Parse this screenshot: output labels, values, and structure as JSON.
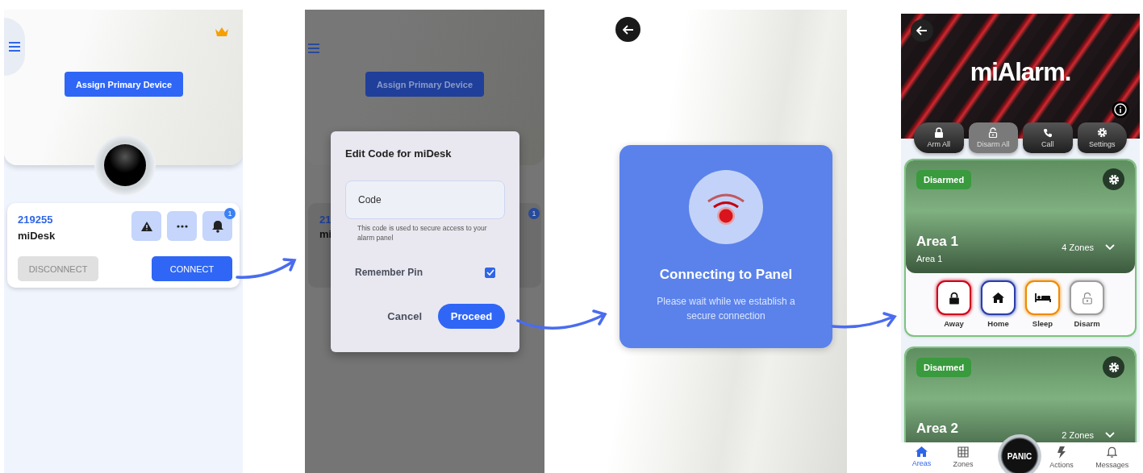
{
  "device_screen": {
    "assign_button": "Assign Primary Device",
    "device": {
      "number": "219255",
      "name": "miDesk",
      "notification_count": "1"
    },
    "buttons": [
      {
        "label": "DISCONNECT",
        "disabled": true
      },
      {
        "label": "CONNECT",
        "disabled": false
      }
    ]
  },
  "code_screen": {
    "background": {
      "assign_button": "Assign Primary Device",
      "number": "21",
      "name": "mi",
      "notification_count": "1"
    },
    "dialog": {
      "title": "Edit Code for miDesk",
      "field": {
        "placeholder": "Code"
      },
      "helper": "This code is used to secure access to your alarm panel",
      "remember": {
        "label": "Remember Pin",
        "checked": true
      },
      "buttons": [
        "Cancel",
        "Proceed"
      ]
    }
  },
  "connecting_screen": {
    "title": "Connecting to Panel",
    "message": "Please wait while we establish a secure connection"
  },
  "alarm_screen": {
    "logo": "miAlarm.",
    "quick_actions": [
      {
        "label": "Arm All",
        "selected": false
      },
      {
        "label": "Disarm All",
        "selected": true
      },
      {
        "label": "Call",
        "selected": false
      },
      {
        "label": "Settings",
        "selected": false
      }
    ],
    "areas": [
      {
        "status": "Disarmed",
        "name": "Area 1",
        "subtitle": "Area 1",
        "zones": "4 Zones",
        "modes": [
          {
            "label": "Away",
            "color": "#d0021b"
          },
          {
            "label": "Home",
            "color": "#2b3fa8"
          },
          {
            "label": "Sleep",
            "color": "#f08a00"
          },
          {
            "label": "Disarm",
            "color": "#9e9e9e"
          }
        ]
      },
      {
        "status": "Disarmed",
        "name": "Area 2",
        "zones": "2 Zones"
      }
    ],
    "panic": "PANIC",
    "nav": [
      {
        "label": "Areas",
        "selected": true
      },
      {
        "label": "Zones",
        "selected": false
      },
      {
        "label": "Actions",
        "selected": false
      },
      {
        "label": "Messages",
        "selected": false
      }
    ]
  }
}
